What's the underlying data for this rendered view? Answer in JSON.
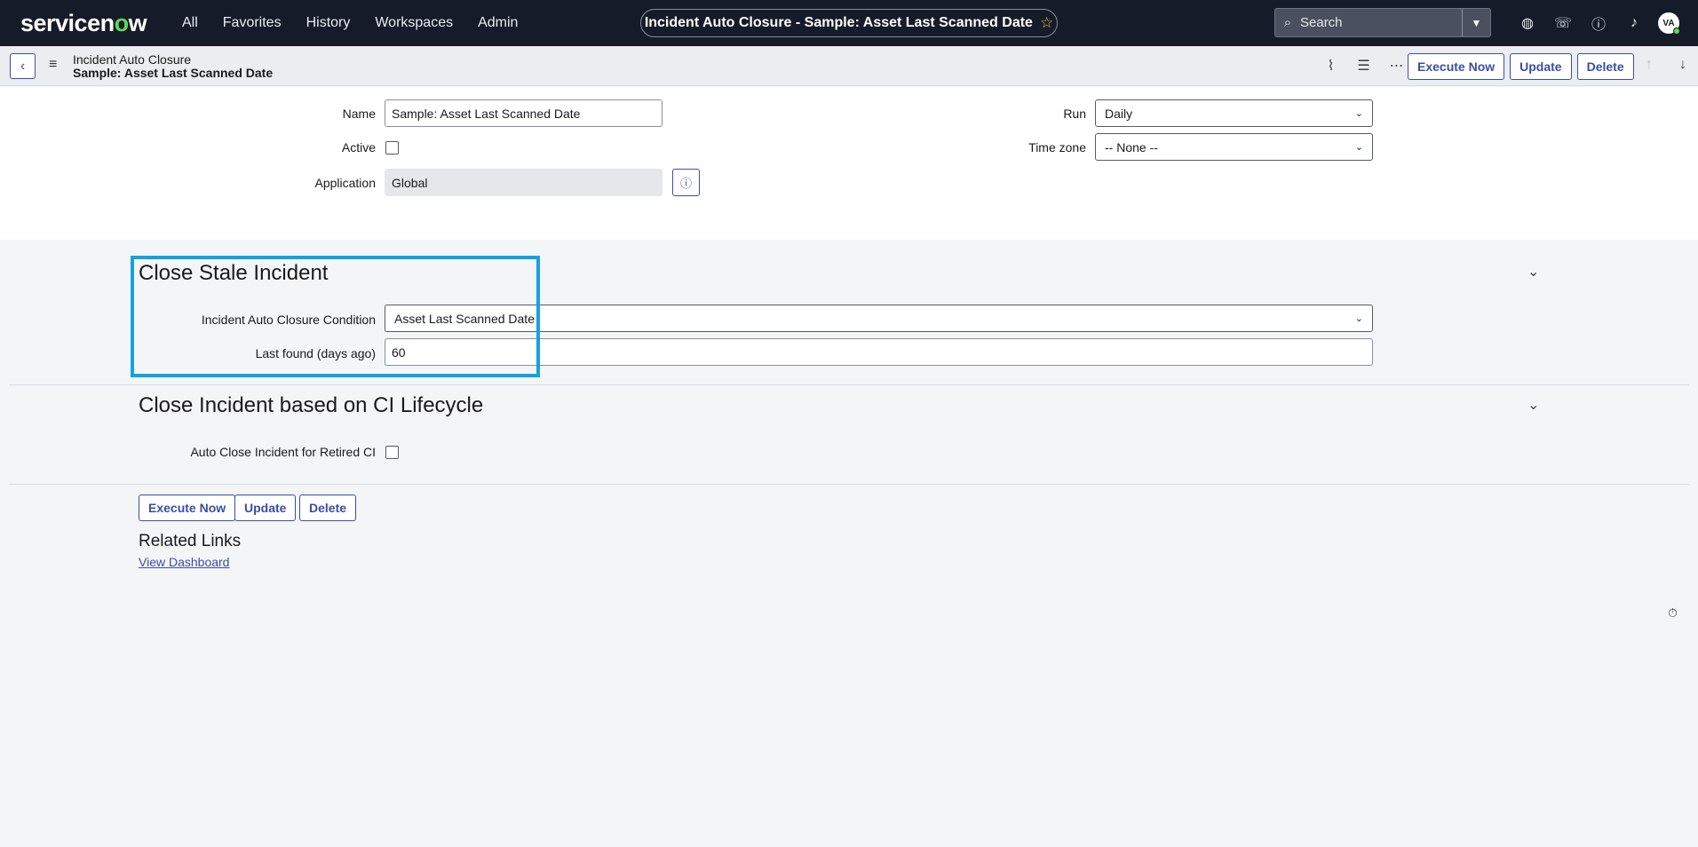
{
  "nav": {
    "logo_main": "servicen",
    "logo_o": "o",
    "logo_end": "w",
    "links": [
      "All",
      "Favorites",
      "History",
      "Workspaces",
      "Admin"
    ],
    "title": "Incident Auto Closure - Sample: Asset Last Scanned Date",
    "search_placeholder": "Search",
    "avatar": "VA"
  },
  "header": {
    "crumb_table": "Incident Auto Closure",
    "crumb_record": "Sample: Asset Last Scanned Date",
    "buttons": {
      "execute": "Execute Now",
      "update": "Update",
      "delete": "Delete"
    }
  },
  "form": {
    "name_label": "Name",
    "name_value": "Sample: Asset Last Scanned Date",
    "active_label": "Active",
    "active_checked": false,
    "application_label": "Application",
    "application_value": "Global",
    "run_label": "Run",
    "run_value": "Daily",
    "timezone_label": "Time zone",
    "timezone_value": "-- None --"
  },
  "section1": {
    "title": "Close Stale Incident",
    "condition_label": "Incident Auto Closure Condition",
    "condition_value": "Asset Last Scanned Date",
    "lastfound_label": "Last found (days ago)",
    "lastfound_value": "60"
  },
  "section2": {
    "title": "Close Incident based on CI Lifecycle",
    "retired_label": "Auto Close Incident for Retired CI",
    "retired_checked": false
  },
  "footer": {
    "buttons": {
      "execute": "Execute Now",
      "update": "Update",
      "delete": "Delete"
    },
    "related_title": "Related Links",
    "view_dashboard": "View Dashboard"
  },
  "colors": {
    "nav_bg": "#161b29",
    "accent": "#3a4da6",
    "brand_green": "#62d84e",
    "highlight": "#14a3e0"
  }
}
